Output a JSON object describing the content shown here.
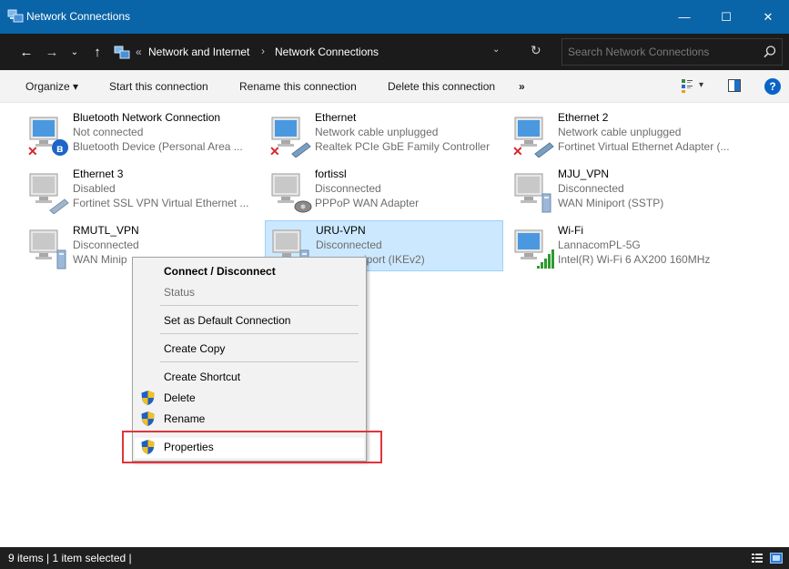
{
  "window": {
    "title": "Network Connections",
    "minimize_glyph": "—",
    "maximize_glyph": "☐",
    "close_glyph": "✕"
  },
  "nav": {
    "back_glyph": "←",
    "forward_glyph": "→",
    "recent_glyph": "⌄",
    "up_glyph": "↑",
    "refresh_glyph": "↻",
    "dropdown_glyph": "⌄"
  },
  "address": {
    "overflow": "«",
    "crumbs": [
      "Network and Internet",
      "Network Connections"
    ],
    "separator": "›"
  },
  "search": {
    "placeholder": "Search Network Connections"
  },
  "commands": {
    "organize": "Organize ▾",
    "start": "Start this connection",
    "rename": "Rename this connection",
    "delete": "Delete this connection",
    "more": "»",
    "views_arrow": "▾",
    "help": "?"
  },
  "items": [
    {
      "name": "Bluetooth Network Connection",
      "status": "Not connected",
      "device": "Bluetooth Device (Personal Area ...",
      "icon": "bluetooth-disconnected-icon"
    },
    {
      "name": "Ethernet",
      "status": "Network cable unplugged",
      "device": "Realtek PCIe GbE Family Controller",
      "icon": "ethernet-unplugged-icon"
    },
    {
      "name": "Ethernet 2",
      "status": "Network cable unplugged",
      "device": "Fortinet Virtual Ethernet Adapter (...",
      "icon": "ethernet-unplugged-icon"
    },
    {
      "name": "Ethernet 3",
      "status": "Disabled",
      "device": "Fortinet SSL VPN Virtual Ethernet ...",
      "icon": "ethernet-disabled-icon"
    },
    {
      "name": "fortissl",
      "status": "Disconnected",
      "device": "PPPoP WAN Adapter",
      "icon": "dialup-icon"
    },
    {
      "name": "MJU_VPN",
      "status": "Disconnected",
      "device": "WAN Miniport (SSTP)",
      "icon": "vpn-icon"
    },
    {
      "name": "RMUTL_VPN",
      "status": "Disconnected",
      "device": "WAN Minip",
      "icon": "vpn-icon"
    },
    {
      "name": "URU-VPN",
      "status": "Disconnected",
      "device": "iport (IKEv2)",
      "icon": "vpn-icon"
    },
    {
      "name": "Wi-Fi",
      "status": "LannacomPL-5G",
      "device": "Intel(R) Wi-Fi 6 AX200 160MHz",
      "icon": "wifi-icon"
    }
  ],
  "context_menu": {
    "connect": "Connect / Disconnect",
    "status": "Status",
    "set_default": "Set as Default Connection",
    "create_copy": "Create Copy",
    "create_shortcut": "Create Shortcut",
    "delete": "Delete",
    "rename": "Rename",
    "properties": "Properties"
  },
  "status_bar": {
    "text": "9 items  |  1 item selected  |"
  },
  "colors": {
    "title_bar": "#0a64a8",
    "address_bar": "#1b1b1b",
    "selection": "#cce8ff",
    "highlight_box": "#e0343c"
  }
}
